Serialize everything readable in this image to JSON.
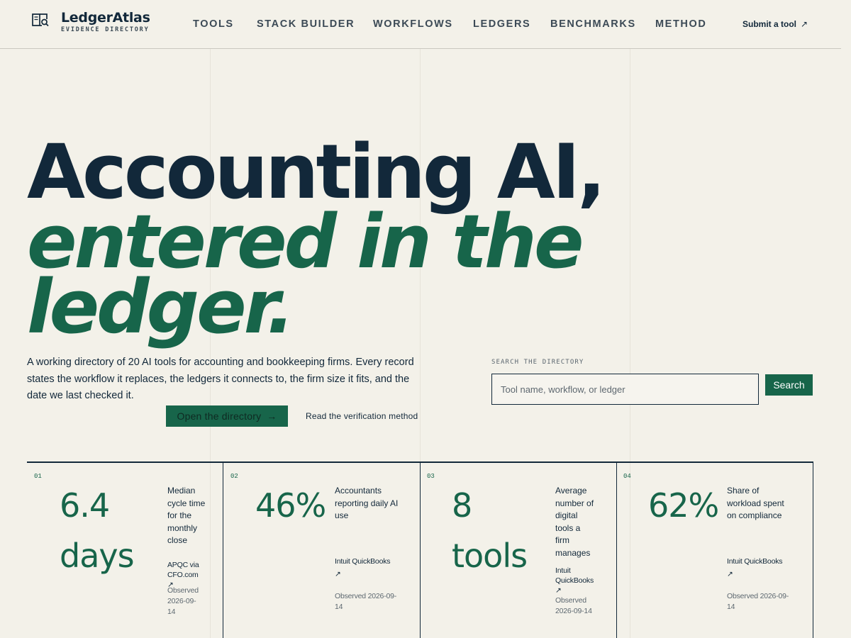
{
  "brand": {
    "name": "LedgerAtlas",
    "tagline": "EVIDENCE DIRECTORY",
    "logo_icon": "book-search-icon"
  },
  "nav": {
    "items": [
      {
        "label": "TOOLS"
      },
      {
        "label": "STACK BUILDER"
      },
      {
        "label": "WORKFLOWS"
      },
      {
        "label": "LEDGERS"
      },
      {
        "label": "BENCHMARKS"
      },
      {
        "label": "METHOD"
      }
    ],
    "submit_label": "Submit a tool",
    "submit_arrow": "↗"
  },
  "hero": {
    "line1": "Accounting AI,",
    "line2": "entered in the",
    "line3": "ledger.",
    "intro": "A working directory of 20 AI tools for accounting and bookkeeping firms. Every record states the workflow it replaces, the ledgers it connects to, the firm size it fits, and the date we last checked it.",
    "primary_button": "Open the directory",
    "primary_arrow": "→",
    "secondary_link": "Read the verification method"
  },
  "search": {
    "label": "SEARCH THE DIRECTORY",
    "placeholder": "Tool name, workflow, or ledger",
    "button": "Search"
  },
  "stats": [
    {
      "num": "01",
      "value_l1": "6.4",
      "value_l2": "days",
      "label": "Median cycle time for the monthly close",
      "source": "APQC via CFO.com",
      "source_arrow": "↗",
      "observed": "Observed 2026-09-14"
    },
    {
      "num": "02",
      "value_l1": "46%",
      "value_l2": "",
      "label": "Accountants reporting daily AI use",
      "source": "Intuit QuickBooks",
      "source_arrow": "↗",
      "observed": "Observed 2026-09-14"
    },
    {
      "num": "03",
      "value_l1": "8",
      "value_l2": "tools",
      "label": "Average number of digital tools a firm manages",
      "source": "Intuit QuickBooks",
      "source_arrow": "↗",
      "observed": "Observed 2026-09-14"
    },
    {
      "num": "04",
      "value_l1": "62%",
      "value_l2": "",
      "label": "Share of workload spent on compliance",
      "source": "Intuit QuickBooks",
      "source_arrow": "↗",
      "observed": "Observed 2026-09-14"
    }
  ]
}
